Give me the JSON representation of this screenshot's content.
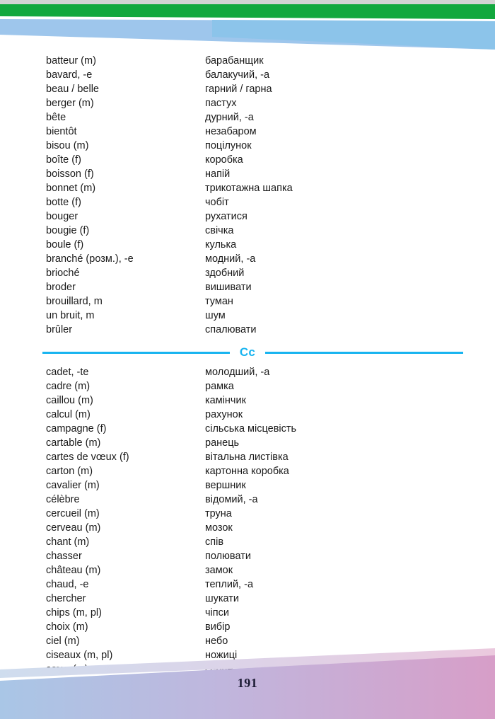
{
  "page": {
    "number": "191",
    "accent_blue": "#18b4f0",
    "band_green": "#12a83e",
    "band_blue": "#8cc4ea",
    "footer_left": "#a9c6e6",
    "footer_right": "#d79ec8",
    "text_color": "#1a1a1a"
  },
  "decor": {
    "top_strip_name": "top-grey-strip",
    "green_band_name": "green-diagonal-band",
    "blue_band_name": "blue-diagonal-band",
    "footer_band_name": "footer-gradient-band"
  },
  "sections": [
    {
      "letter": "",
      "has_divider": false,
      "entries": [
        {
          "term": "batteur (m)",
          "gloss": "барабанщик"
        },
        {
          "term": "bavard, -e",
          "gloss": "балакучий, -а"
        },
        {
          "term": "beau / belle",
          "gloss": "гарний / гарна"
        },
        {
          "term": "berger (m)",
          "gloss": "пастух"
        },
        {
          "term": "bête",
          "gloss": "дурний, -а"
        },
        {
          "term": "bientôt",
          "gloss": "незабаром"
        },
        {
          "term": "bisou (m)",
          "gloss": "поцілунок"
        },
        {
          "term": "boîte (f)",
          "gloss": "коробка"
        },
        {
          "term": "boisson (f)",
          "gloss": "напій"
        },
        {
          "term": "bonnet (m)",
          "gloss": "трикотажна шапка"
        },
        {
          "term": "botte (f)",
          "gloss": "чобіт"
        },
        {
          "term": "bouger",
          "gloss": "рухатися"
        },
        {
          "term": "bougie (f)",
          "gloss": "свічка"
        },
        {
          "term": "boule (f)",
          "gloss": "кулька"
        },
        {
          "term": "branché (розм.), -e",
          "gloss": "модний, -а"
        },
        {
          "term": "brioché",
          "gloss": "здобний"
        },
        {
          "term": "broder",
          "gloss": "вишивати"
        },
        {
          "term": "brouillard, m",
          "gloss": "туман"
        },
        {
          "term": "un bruit, m",
          "gloss": "шум"
        },
        {
          "term": "brûler",
          "gloss": "спалювати"
        }
      ]
    },
    {
      "letter": "Cc",
      "has_divider": true,
      "entries": [
        {
          "term": "cadet, -te",
          "gloss": "молодший, -а"
        },
        {
          "term": "cadre (m)",
          "gloss": "рамка"
        },
        {
          "term": "caillou (m)",
          "gloss": "камінчик"
        },
        {
          "term": "calcul (m)",
          "gloss": "рахунок"
        },
        {
          "term": "campagne (f)",
          "gloss": "сільська місцевість"
        },
        {
          "term": "cartable (m)",
          "gloss": "ранець"
        },
        {
          "term": "cartes de vœux (f)",
          "gloss": "вітальна листівка"
        },
        {
          "term": "carton (m)",
          "gloss": "картонна коробка"
        },
        {
          "term": "cavalier (m)",
          "gloss": "вершник"
        },
        {
          "term": "célèbre",
          "gloss": "відомий, -а"
        },
        {
          "term": "cercueil (m)",
          "gloss": "труна"
        },
        {
          "term": "cerveau (m)",
          "gloss": "мозок"
        },
        {
          "term": "chant (m)",
          "gloss": "спів"
        },
        {
          "term": "chasser",
          "gloss": "полювати"
        },
        {
          "term": "château (m)",
          "gloss": "замок"
        },
        {
          "term": "chaud, -e",
          "gloss": "теплий, -а"
        },
        {
          "term": "chercher",
          "gloss": "шукати"
        },
        {
          "term": "chips (m, pl)",
          "gloss": "чіпси"
        },
        {
          "term": "choix (m)",
          "gloss": "вибір"
        },
        {
          "term": "ciel (m)",
          "gloss": "небо"
        },
        {
          "term": "ciseaux (m, pl)",
          "gloss": "ножиці"
        },
        {
          "term": "cœur (m)",
          "gloss": "серце"
        }
      ]
    }
  ]
}
